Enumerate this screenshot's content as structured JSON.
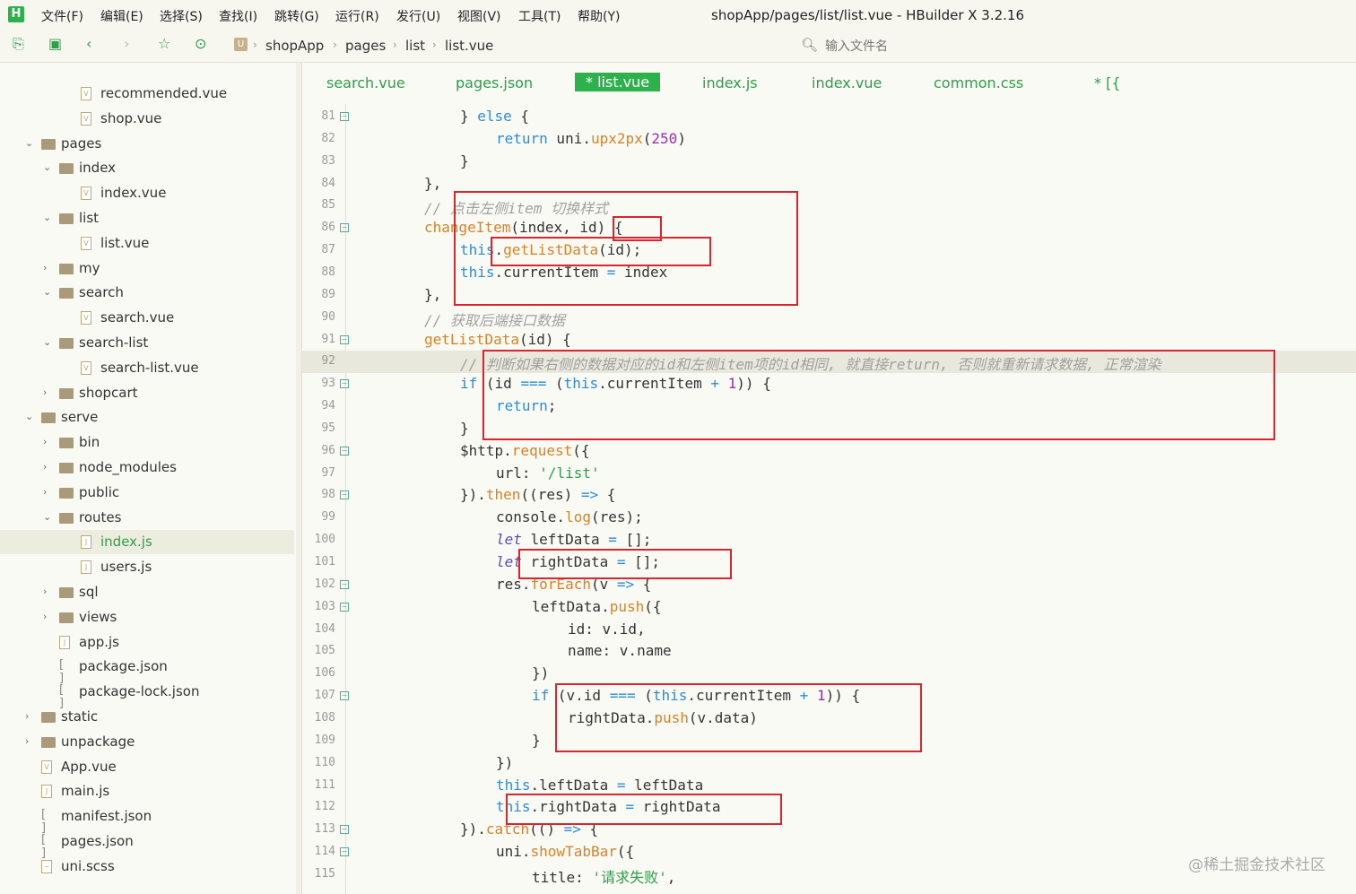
{
  "app": {
    "logo": "H",
    "title": "shopApp/pages/list/list.vue - HBuilder X 3.2.16"
  },
  "menu": [
    "文件(F)",
    "编辑(E)",
    "选择(S)",
    "查找(I)",
    "跳转(G)",
    "运行(R)",
    "发行(U)",
    "视图(V)",
    "工具(T)",
    "帮助(Y)"
  ],
  "breadcrumb": [
    "shopApp",
    "pages",
    "list",
    "list.vue"
  ],
  "file_search": {
    "placeholder": "输入文件名"
  },
  "tabs": [
    {
      "label": "search.vue",
      "active": false
    },
    {
      "label": "pages.json",
      "active": false
    },
    {
      "label": "* list.vue",
      "active": true
    },
    {
      "label": "index.js",
      "active": false
    },
    {
      "label": "index.vue",
      "active": false
    },
    {
      "label": "common.css",
      "active": false
    },
    {
      "label": "* [{",
      "active": false
    }
  ],
  "tree": [
    {
      "label": "recommended.vue",
      "type": "vue"
    },
    {
      "label": "shop.vue",
      "type": "vue"
    },
    {
      "label": "pages",
      "type": "folder",
      "expanded": true
    },
    {
      "label": "index",
      "type": "folder",
      "expanded": true
    },
    {
      "label": "index.vue",
      "type": "vue"
    },
    {
      "label": "list",
      "type": "folder",
      "expanded": true
    },
    {
      "label": "list.vue",
      "type": "vue"
    },
    {
      "label": "my",
      "type": "folder",
      "expanded": false
    },
    {
      "label": "search",
      "type": "folder",
      "expanded": true
    },
    {
      "label": "search.vue",
      "type": "vue"
    },
    {
      "label": "search-list",
      "type": "folder",
      "expanded": true
    },
    {
      "label": "search-list.vue",
      "type": "vue"
    },
    {
      "label": "shopcart",
      "type": "folder",
      "expanded": false
    },
    {
      "label": "serve",
      "type": "folder",
      "expanded": true
    },
    {
      "label": "bin",
      "type": "folder",
      "expanded": false
    },
    {
      "label": "node_modules",
      "type": "folder",
      "expanded": false
    },
    {
      "label": "public",
      "type": "folder",
      "expanded": false
    },
    {
      "label": "routes",
      "type": "folder",
      "expanded": true
    },
    {
      "label": "index.js",
      "type": "js",
      "selected": true
    },
    {
      "label": "users.js",
      "type": "js"
    },
    {
      "label": "sql",
      "type": "folder",
      "expanded": false
    },
    {
      "label": "views",
      "type": "folder",
      "expanded": false
    },
    {
      "label": "app.js",
      "type": "js"
    },
    {
      "label": "package.json",
      "type": "json"
    },
    {
      "label": "package-lock.json",
      "type": "json"
    },
    {
      "label": "static",
      "type": "folder",
      "expanded": false
    },
    {
      "label": "unpackage",
      "type": "folder",
      "expanded": false
    },
    {
      "label": "App.vue",
      "type": "vue"
    },
    {
      "label": "main.js",
      "type": "js"
    },
    {
      "label": "manifest.json",
      "type": "json"
    },
    {
      "label": "pages.json",
      "type": "json"
    },
    {
      "label": "uni.scss",
      "type": "scss"
    }
  ],
  "code_lines": [
    {
      "n": "81",
      "fold": true,
      "segs": [
        [
          "} ",
          ""
        ],
        [
          "else",
          "kw"
        ],
        [
          " {",
          ""
        ]
      ]
    },
    {
      "n": "82",
      "fold": false,
      "segs": [
        [
          "return",
          "kw"
        ],
        [
          " uni.",
          ""
        ],
        [
          "upx2px",
          "fn"
        ],
        [
          "(",
          ""
        ],
        [
          "250",
          "num"
        ],
        [
          ")",
          ""
        ]
      ]
    },
    {
      "n": "83",
      "fold": false,
      "segs": [
        [
          "}",
          ""
        ]
      ]
    },
    {
      "n": "84",
      "fold": false,
      "segs": [
        [
          "},",
          ""
        ]
      ]
    },
    {
      "n": "85",
      "fold": false,
      "segs": [
        [
          "// 点击左侧item 切换样式",
          "comment"
        ]
      ]
    },
    {
      "n": "86",
      "fold": true,
      "segs": [
        [
          "changeItem",
          "fn"
        ],
        [
          "(index, id) {",
          ""
        ]
      ]
    },
    {
      "n": "87",
      "fold": false,
      "segs": [
        [
          "this",
          "kw"
        ],
        [
          ".",
          ""
        ],
        [
          "getListData",
          "fn"
        ],
        [
          "(id);",
          ""
        ]
      ]
    },
    {
      "n": "88",
      "fold": false,
      "segs": [
        [
          "this",
          "kw"
        ],
        [
          ".currentItem ",
          ""
        ],
        [
          "=",
          "op"
        ],
        [
          " index",
          ""
        ]
      ]
    },
    {
      "n": "89",
      "fold": false,
      "segs": [
        [
          "},",
          ""
        ]
      ]
    },
    {
      "n": "90",
      "fold": false,
      "segs": [
        [
          "// 获取后端接口数据",
          "comment"
        ]
      ]
    },
    {
      "n": "91",
      "fold": true,
      "segs": [
        [
          "getListData",
          "fn"
        ],
        [
          "(id) {",
          ""
        ]
      ]
    },
    {
      "n": "92",
      "fold": false,
      "current": true,
      "segs": [
        [
          "// 判断如果右侧的数据对应的id和左侧item项的id相同, 就直接return, 否则就重新请求数据, 正常渲染",
          "comment"
        ]
      ]
    },
    {
      "n": "93",
      "fold": true,
      "segs": [
        [
          "if",
          "kw"
        ],
        [
          " (id ",
          ""
        ],
        [
          "===",
          "op"
        ],
        [
          " (",
          ""
        ],
        [
          "this",
          "kw"
        ],
        [
          ".currentItem ",
          ""
        ],
        [
          "+",
          "op"
        ],
        [
          " ",
          ""
        ],
        [
          "1",
          "num"
        ],
        [
          ")) {",
          ""
        ]
      ]
    },
    {
      "n": "94",
      "fold": false,
      "segs": [
        [
          "return",
          "kw"
        ],
        [
          ";",
          ""
        ]
      ]
    },
    {
      "n": "95",
      "fold": false,
      "segs": [
        [
          "}",
          ""
        ]
      ]
    },
    {
      "n": "96",
      "fold": true,
      "segs": [
        [
          "$http.",
          ""
        ],
        [
          "request",
          "fn"
        ],
        [
          "({",
          ""
        ]
      ]
    },
    {
      "n": "97",
      "fold": false,
      "segs": [
        [
          "url: ",
          ""
        ],
        [
          "'/list'",
          "str"
        ]
      ]
    },
    {
      "n": "98",
      "fold": true,
      "segs": [
        [
          "}).",
          ""
        ],
        [
          "then",
          "fn"
        ],
        [
          "((res) ",
          ""
        ],
        [
          "=>",
          "op"
        ],
        [
          " {",
          ""
        ]
      ]
    },
    {
      "n": "99",
      "fold": false,
      "segs": [
        [
          "console.",
          ""
        ],
        [
          "log",
          "fn"
        ],
        [
          "(res);",
          ""
        ]
      ]
    },
    {
      "n": "100",
      "fold": false,
      "segs": [
        [
          "let",
          "italic"
        ],
        [
          " leftData ",
          ""
        ],
        [
          "=",
          "op"
        ],
        [
          " [];",
          ""
        ]
      ]
    },
    {
      "n": "101",
      "fold": false,
      "segs": [
        [
          "let",
          "italic"
        ],
        [
          " rightData ",
          ""
        ],
        [
          "=",
          "op"
        ],
        [
          " [];",
          ""
        ]
      ]
    },
    {
      "n": "102",
      "fold": true,
      "segs": [
        [
          "res.",
          ""
        ],
        [
          "forEach",
          "fn"
        ],
        [
          "(v ",
          ""
        ],
        [
          "=>",
          "op"
        ],
        [
          " {",
          ""
        ]
      ]
    },
    {
      "n": "103",
      "fold": true,
      "segs": [
        [
          "leftData.",
          ""
        ],
        [
          "push",
          "fn"
        ],
        [
          "({",
          ""
        ]
      ]
    },
    {
      "n": "104",
      "fold": false,
      "segs": [
        [
          "id: v.id,",
          ""
        ]
      ]
    },
    {
      "n": "105",
      "fold": false,
      "segs": [
        [
          "name: v.name",
          ""
        ]
      ]
    },
    {
      "n": "106",
      "fold": false,
      "segs": [
        [
          "})",
          ""
        ]
      ]
    },
    {
      "n": "107",
      "fold": true,
      "segs": [
        [
          "if",
          "kw"
        ],
        [
          " (v.id ",
          ""
        ],
        [
          "===",
          "op"
        ],
        [
          " (",
          ""
        ],
        [
          "this",
          "kw"
        ],
        [
          ".currentItem ",
          ""
        ],
        [
          "+",
          "op"
        ],
        [
          " ",
          ""
        ],
        [
          "1",
          "num"
        ],
        [
          ")) {",
          ""
        ]
      ]
    },
    {
      "n": "108",
      "fold": false,
      "segs": [
        [
          "rightData.",
          ""
        ],
        [
          "push",
          "fn"
        ],
        [
          "(v.data)",
          ""
        ]
      ]
    },
    {
      "n": "109",
      "fold": false,
      "segs": [
        [
          "}",
          ""
        ]
      ]
    },
    {
      "n": "110",
      "fold": false,
      "segs": [
        [
          "})",
          ""
        ]
      ]
    },
    {
      "n": "111",
      "fold": false,
      "segs": [
        [
          "this",
          "kw"
        ],
        [
          ".leftData ",
          ""
        ],
        [
          "=",
          "op"
        ],
        [
          " leftData",
          ""
        ]
      ]
    },
    {
      "n": "112",
      "fold": false,
      "segs": [
        [
          "this",
          "kw"
        ],
        [
          ".rightData ",
          ""
        ],
        [
          "=",
          "op"
        ],
        [
          " rightData",
          ""
        ]
      ]
    },
    {
      "n": "113",
      "fold": true,
      "segs": [
        [
          "}).",
          ""
        ],
        [
          "catch",
          "fn"
        ],
        [
          "(() ",
          ""
        ],
        [
          "=>",
          "op"
        ],
        [
          " {",
          ""
        ]
      ]
    },
    {
      "n": "114",
      "fold": true,
      "segs": [
        [
          "uni.",
          ""
        ],
        [
          "showTabBar",
          "fn"
        ],
        [
          "({",
          ""
        ]
      ]
    },
    {
      "n": "115",
      "fold": false,
      "segs": [
        [
          "title: ",
          ""
        ],
        [
          "'请求失败'",
          "str"
        ],
        [
          ",",
          ""
        ]
      ]
    }
  ],
  "watermark": "@稀土掘金技术社区",
  "colors": {
    "accent": "#2db14a",
    "highlight_box": "#d9252d",
    "keyword": "#2e8bd6",
    "function": "#d8822a",
    "comment": "#a0a0a0",
    "number": "#9a2db8",
    "string": "#2e9e4a"
  }
}
